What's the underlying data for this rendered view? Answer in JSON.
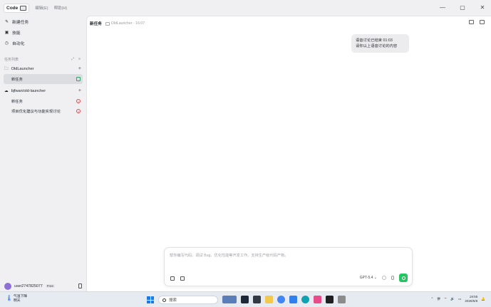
{
  "titlebar": {
    "app_label": "Code",
    "menu": [
      "编辑(E)",
      "帮助(H)"
    ]
  },
  "sidebar": {
    "nav": [
      {
        "label": "新建任务",
        "icon": "edit-icon"
      },
      {
        "label": "技能",
        "icon": "skills-icon"
      },
      {
        "label": "自动化",
        "icon": "clock-icon"
      }
    ],
    "section_label": "任务列表",
    "groups": [
      {
        "name": "OldLauncher",
        "tasks": [
          {
            "label": "新任务",
            "active": true,
            "status": "new"
          }
        ]
      },
      {
        "name": "bjfwan/old-launcher",
        "tasks": [
          {
            "label": "新任务",
            "active": false,
            "status": "error"
          },
          {
            "label": "项目优化建议与功能实现讨论",
            "active": false,
            "status": "error"
          }
        ]
      }
    ],
    "user": {
      "name": "user2747825077",
      "plan": "Free"
    }
  },
  "main": {
    "title": "新任务",
    "breadcrumb": "OldLauncher · 16:07",
    "message_lines": [
      "语音讨论已结束 01:03",
      "请你以上语音讨论的内容"
    ],
    "composer_placeholder": "帮你编写代码、调试 Bug、优化性能等开发工作。支持生产级代码产物。",
    "model": "GPT-5.4",
    "model_caret": "⌄"
  },
  "taskbar": {
    "weather_title": "气温下降",
    "weather_sub": "明天",
    "search_label": "搜索",
    "time": "19:55",
    "date": "2026/5/6",
    "lang": "拼"
  },
  "colors": {
    "accent_send": "#22c55e",
    "error": "#e5484d",
    "active_task_bg": "#dcdde1"
  }
}
